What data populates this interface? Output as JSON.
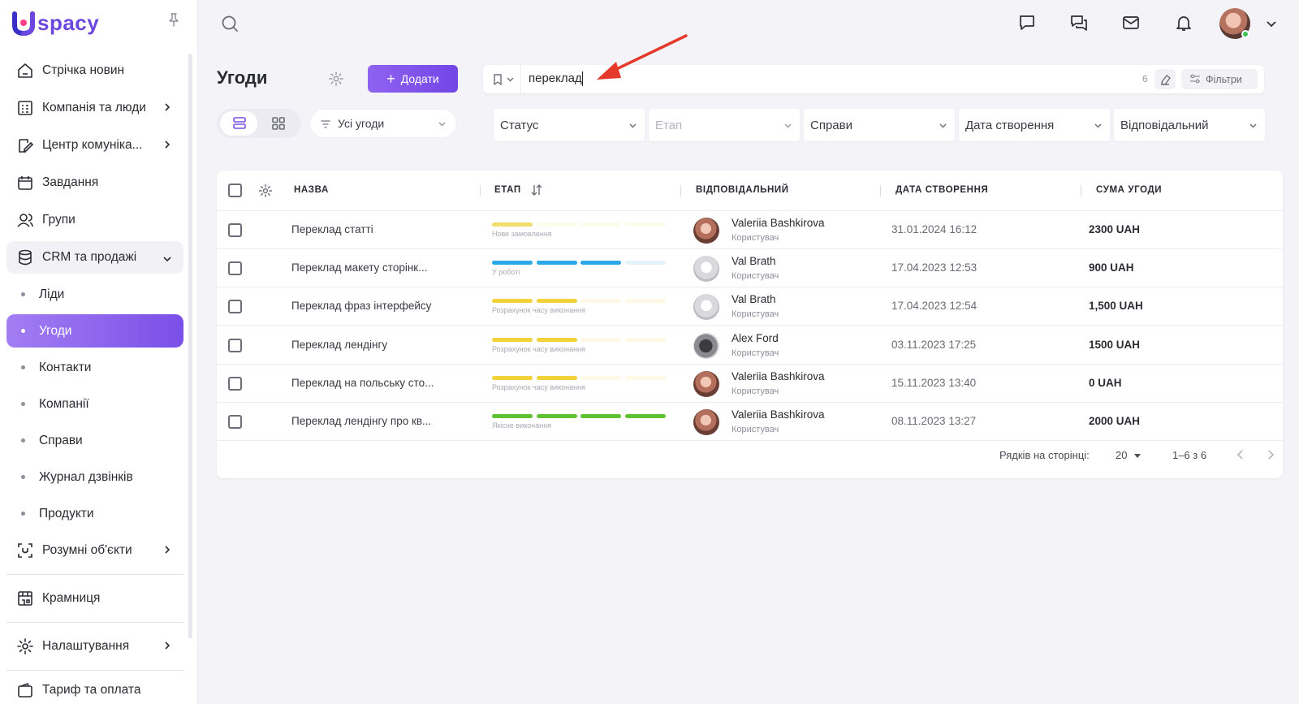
{
  "app": {
    "logo_text": "spacy",
    "colors": {
      "accent": "#7a4fe8",
      "accent_light": "#a37ef3",
      "online": "#3cc35a"
    }
  },
  "sidebar": {
    "items": [
      {
        "label": "Стрічка новин",
        "icon": "home-icon"
      },
      {
        "label": "Компанія та люди",
        "icon": "company-icon",
        "expandable": true
      },
      {
        "label": "Центр комуніка...",
        "icon": "communication-icon",
        "expandable": true
      },
      {
        "label": "Завдання",
        "icon": "calendar-icon"
      },
      {
        "label": "Групи",
        "icon": "users-icon"
      },
      {
        "label": "CRM та продажі",
        "icon": "database-icon",
        "expanded": true
      }
    ],
    "crm_sub": [
      {
        "label": "Ліди"
      },
      {
        "label": "Угоди",
        "active": true
      },
      {
        "label": "Контакти"
      },
      {
        "label": "Компанії"
      },
      {
        "label": "Справи"
      },
      {
        "label": "Журнал дзвінків"
      },
      {
        "label": "Продукти"
      }
    ],
    "smart_objects": "Розумні об'єкти",
    "store": "Крамниця",
    "settings": "Налаштування",
    "billing": "Тариф та оплата"
  },
  "topbar": {
    "icons": [
      "search-icon",
      "chat-icon",
      "messages-icon",
      "mail-icon",
      "bell-icon",
      "user-avatar",
      "chevron-down-icon"
    ]
  },
  "page": {
    "title": "Угоди",
    "add_button": "Додати",
    "deals_scope": "Усі угоди"
  },
  "search": {
    "value": "переклад",
    "count": "6",
    "filters_label": "Фільтри"
  },
  "filters": [
    {
      "label": "Статус",
      "placeholder": false
    },
    {
      "label": "Етап",
      "placeholder": true
    },
    {
      "label": "Справи",
      "placeholder": false
    },
    {
      "label": "Дата створення",
      "placeholder": false
    },
    {
      "label": "Відповідальний",
      "placeholder": false
    }
  ],
  "table": {
    "columns": [
      "НАЗВА",
      "ЕТАП",
      "ВІДПОВІДАЛЬНИЙ",
      "ДАТА СТВОРЕННЯ",
      "СУМА УГОДИ"
    ],
    "rows": [
      {
        "name": "Переклад статті",
        "stage": "Нове замовлення",
        "stage_color": "#f2df6b",
        "stage_filled": 1,
        "user": "Valeriia Bashkirova",
        "role": "Користувач",
        "avatar": "v",
        "date": "31.01.2024 16:12",
        "sum": "2300 UAH"
      },
      {
        "name": "Переклад макету сторінк...",
        "stage": "У роботі",
        "stage_color": "#2aa8e8",
        "stage_filled": 3,
        "user": "Val Brath",
        "role": "Користувач",
        "avatar": "b",
        "date": "17.04.2023 12:53",
        "sum": "900 UAH"
      },
      {
        "name": "Переклад фраз інтерфейсу",
        "stage": "Розрахунок часу виконання",
        "stage_color": "#f2d23a",
        "stage_filled": 2,
        "user": "Val Brath",
        "role": "Користувач",
        "avatar": "b",
        "date": "17.04.2023 12:54",
        "sum": "1,500 UAH"
      },
      {
        "name": "Переклад лендінгу",
        "stage": "Розрахунок часу виконання",
        "stage_color": "#f2d23a",
        "stage_filled": 2,
        "user": "Alex Ford",
        "role": "Користувач",
        "avatar": "a",
        "date": "03.11.2023 17:25",
        "sum": "1500 UAH"
      },
      {
        "name": "Переклад на польську сто...",
        "stage": "Розрахунок часу виконання",
        "stage_color": "#f2d23a",
        "stage_filled": 2,
        "user": "Valeriia Bashkirova",
        "role": "Користувач",
        "avatar": "v",
        "date": "15.11.2023 13:40",
        "sum": "0 UAH"
      },
      {
        "name": "Переклад лендінгу про кв...",
        "stage": "Якісне виконання",
        "stage_color": "#5fc22f",
        "stage_filled": 4,
        "user": "Valeriia Bashkirova",
        "role": "Користувач",
        "avatar": "v",
        "date": "08.11.2023 13:27",
        "sum": "2000 UAH"
      }
    ]
  },
  "pagination": {
    "rows_per_page_label": "Рядків на сторінці:",
    "rows_per_page": "20",
    "range": "1–6 з 6"
  }
}
